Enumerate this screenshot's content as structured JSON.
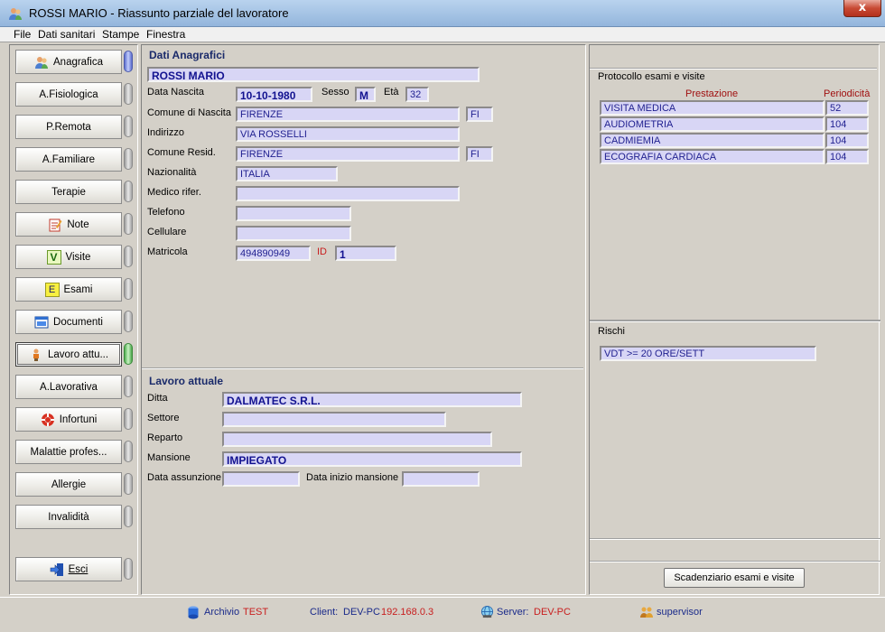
{
  "window": {
    "title": "ROSSI MARIO - Riassunto parziale del lavoratore",
    "close_label": "x"
  },
  "menu": [
    "File",
    "Dati sanitari",
    "Stampe",
    "Finestra"
  ],
  "sidebar": {
    "items": [
      {
        "label": "Anagrafica",
        "icon": "people-icon",
        "led": "blue"
      },
      {
        "label": "A.Fisiologica",
        "icon": "",
        "led": "grey"
      },
      {
        "label": "P.Remota",
        "icon": "",
        "led": "grey"
      },
      {
        "label": "A.Familiare",
        "icon": "",
        "led": "grey"
      },
      {
        "label": "Terapie",
        "icon": "",
        "led": "grey"
      },
      {
        "label": "Note",
        "icon": "notepad-icon",
        "led": "grey"
      },
      {
        "label": "Visite",
        "icon": "v-badge-icon",
        "led": "grey"
      },
      {
        "label": "Esami",
        "icon": "e-badge-icon",
        "led": "grey"
      },
      {
        "label": "Documenti",
        "icon": "document-window-icon",
        "led": "grey"
      },
      {
        "label": "Lavoro attu...",
        "icon": "worker-icon",
        "led": "green"
      },
      {
        "label": "A.Lavorativa",
        "icon": "",
        "led": "grey"
      },
      {
        "label": "Infortuni",
        "icon": "lifebuoy-icon",
        "led": "grey"
      },
      {
        "label": "Malattie profes...",
        "icon": "",
        "led": "grey"
      },
      {
        "label": "Allergie",
        "icon": "",
        "led": "grey"
      },
      {
        "label": "Invalidità",
        "icon": "",
        "led": "grey"
      }
    ],
    "exit_label": "Esci"
  },
  "anagrafica": {
    "title": "Dati Anagrafici",
    "nome": "ROSSI MARIO",
    "data_nascita_label": "Data Nascita",
    "data_nascita": "10-10-1980",
    "sesso_label": "Sesso",
    "sesso": "M",
    "eta_label": "Età",
    "eta": "32",
    "comune_nascita_label": "Comune di Nascita",
    "comune_nascita": "FIRENZE",
    "prov_nascita": "FI",
    "indirizzo_label": "Indirizzo",
    "indirizzo": "VIA ROSSELLI",
    "comune_resid_label": "Comune Resid.",
    "comune_resid": "FIRENZE",
    "prov_resid": "FI",
    "nazionalita_label": "Nazionalità",
    "nazionalita": "ITALIA",
    "medico_label": "Medico rifer.",
    "medico": "",
    "telefono_label": "Telefono",
    "telefono": "",
    "cellulare_label": "Cellulare",
    "cellulare": "",
    "matricola_label": "Matricola",
    "matricola": "494890949",
    "id_label": "ID",
    "id": "1"
  },
  "lavoro": {
    "title": "Lavoro attuale",
    "ditta_label": "Ditta",
    "ditta": "DALMATEC S.R.L.",
    "settore_label": "Settore",
    "settore": "",
    "reparto_label": "Reparto",
    "reparto": "",
    "mansione_label": "Mansione",
    "mansione": "IMPIEGATO",
    "data_assunzione_label": "Data assunzione",
    "data_assunzione": "",
    "data_inizio_label": "Data inizio mansione",
    "data_inizio": ""
  },
  "protocollo": {
    "title": "Protocollo esami e visite",
    "col_prestazione": "Prestazione",
    "col_periodicita": "Periodicità",
    "rows": [
      {
        "prestazione": "VISITA MEDICA",
        "periodicita": "52"
      },
      {
        "prestazione": "AUDIOMETRIA",
        "periodicita": "104"
      },
      {
        "prestazione": "CADMIEMIA",
        "periodicita": "104"
      },
      {
        "prestazione": "ECOGRAFIA CARDIACA",
        "periodicita": "104"
      }
    ]
  },
  "rischi": {
    "title": "Rischi",
    "items": [
      "VDT >= 20 ORE/SETT"
    ]
  },
  "scadenziario_label": "Scadenziario esami e visite",
  "status": {
    "archivio_label": "Archivio",
    "archivio": "TEST",
    "client_label": "Client:",
    "client_name": "DEV-PC",
    "client_ip": "192.168.0.3",
    "server_label": "Server:",
    "server_name": "DEV-PC",
    "user": "supervisor"
  }
}
